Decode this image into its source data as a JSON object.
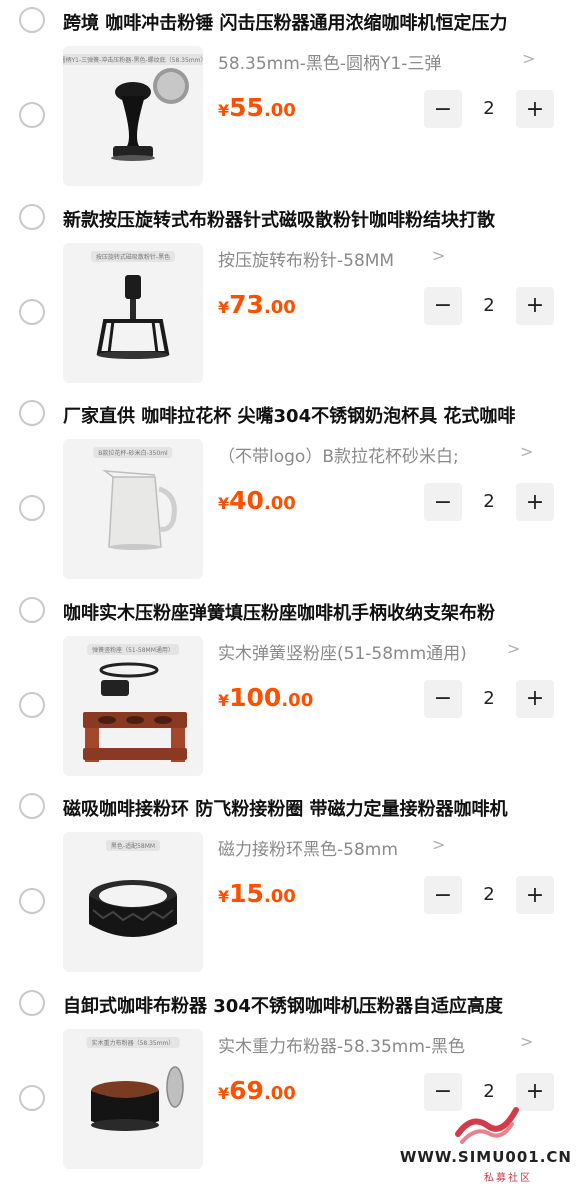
{
  "items": [
    {
      "title": "跨境 咖啡冲击粉锤 闪击压粉器通用浓缩咖啡机恒定压力",
      "thumb_tag": "圆柄Y1-三弹簧-冲击压粉器-黑色-螺纹底（58.35mm）",
      "spec": "58.35mm-黑色-圆柄Y1-三弹",
      "price_currency": "¥",
      "price_int": "55",
      "price_dec": ".00",
      "qty": "2",
      "thumb_icon": "tamper-icon"
    },
    {
      "title": "新款按压旋转式布粉器针式磁吸散粉针咖啡粉结块打散",
      "thumb_tag": "按压旋转式磁吸散粉针-黑色",
      "spec": "按压旋转布粉针-58MM",
      "price_currency": "¥",
      "price_int": "73",
      "price_dec": ".00",
      "qty": "2",
      "thumb_icon": "wdt-tool-icon"
    },
    {
      "title": "厂家直供 咖啡拉花杯 尖嘴304不锈钢奶泡杯具 花式咖啡",
      "thumb_tag": "B款拉花杯-砂米白-350ml",
      "spec": "（不带logo）B款拉花杯砂米白;",
      "price_currency": "¥",
      "price_int": "40",
      "price_dec": ".00",
      "qty": "2",
      "thumb_icon": "milk-pitcher-icon"
    },
    {
      "title": "咖啡实木压粉座弹簧填压粉座咖啡机手柄收纳支架布粉",
      "thumb_tag": "弹簧竖粉座（51-58MM通用）",
      "spec": "实木弹簧竖粉座(51-58mm通用)",
      "price_currency": "¥",
      "price_int": "100",
      "price_dec": ".00",
      "qty": "2",
      "thumb_icon": "tamping-stand-icon"
    },
    {
      "title": "磁吸咖啡接粉环 防飞粉接粉圈 带磁力定量接粉器咖啡机",
      "thumb_tag": "黑色-适配58MM",
      "spec": "磁力接粉环黑色-58mm",
      "price_currency": "¥",
      "price_int": "15",
      "price_dec": ".00",
      "qty": "2",
      "thumb_icon": "dosing-ring-icon"
    },
    {
      "title": "自卸式咖啡布粉器 304不锈钢咖啡机压粉器自适应高度",
      "thumb_tag": "实木重力布粉器（58.35mm）",
      "spec": "实木重力布粉器-58.35mm-黑色",
      "price_currency": "¥",
      "price_int": "69",
      "price_dec": ".00",
      "qty": "2",
      "thumb_icon": "distributor-icon"
    }
  ],
  "controls": {
    "minus": "−",
    "plus": "+",
    "chevron": ">"
  },
  "watermark": {
    "url": "WWW.SIMU001.CN",
    "cn": "私募社区"
  },
  "colors": {
    "price": "#ff5000",
    "stepper_bg": "#f1f1f1",
    "watermark_red": "#d33a4a"
  }
}
